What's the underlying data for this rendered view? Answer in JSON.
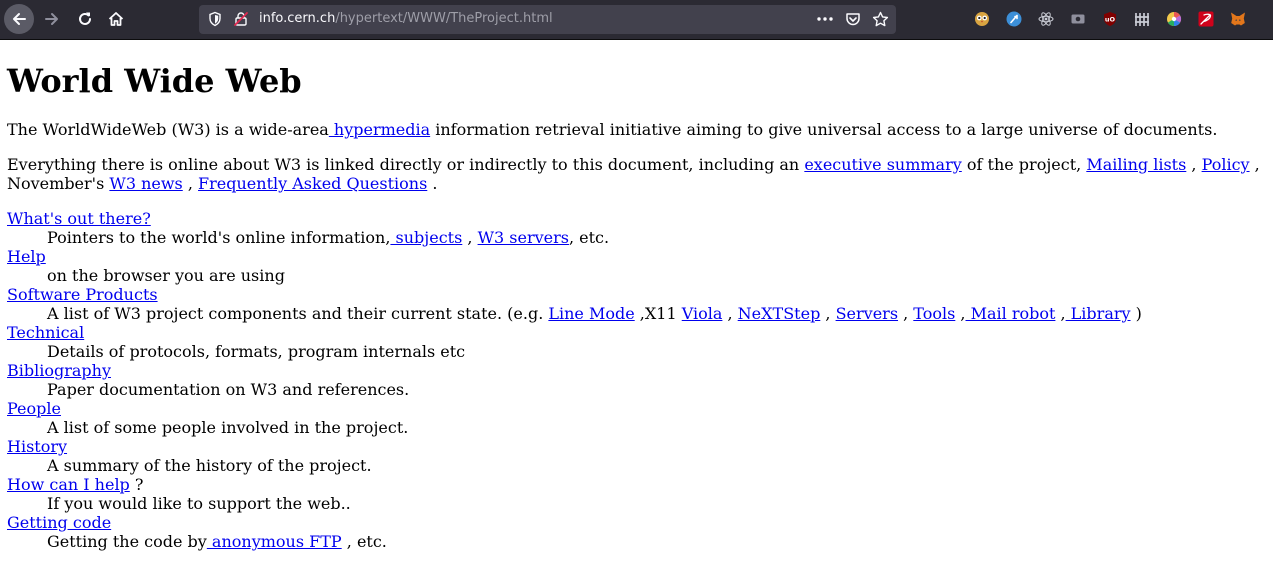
{
  "browser": {
    "url_host": "info.cern.ch",
    "url_path": "/hypertext/WWW/TheProject.html",
    "colors": {
      "toolbar": "#2b2a33",
      "urlbar": "#42414d",
      "link": "#0000ee"
    },
    "extension_icons": [
      "owl-extension-icon",
      "dark-reader-icon",
      "react-devtools-icon",
      "screenshot-icon",
      "ublock-origin-icon",
      "tracker-blocker-icon",
      "color-picker-icon",
      "feather-icon",
      "metamask-fox-icon"
    ]
  },
  "page": {
    "title": "World Wide Web",
    "intro": {
      "t1": "The WorldWideWeb (W3) is a wide-area",
      "link_hypermedia": " hypermedia",
      "t2": " information retrieval initiative aiming to give universal access to a large universe of documents."
    },
    "everything": {
      "t1": "Everything there is online about W3 is linked directly or indirectly to this document, including an ",
      "link_exec": "executive summary",
      "t2": " of the project, ",
      "link_mailing": "Mailing lists",
      "t3": " , ",
      "link_policy": "Policy",
      "t4": " , November's ",
      "link_news": "W3 news",
      "t5": " , ",
      "link_faq": "Frequently Asked Questions",
      "t6": " ."
    },
    "whats_out": {
      "title": "What's out there?",
      "d1": "Pointers to the world's online information,",
      "link_subjects": " subjects",
      "d2": " , ",
      "link_servers": "W3 servers",
      "d3": ", etc."
    },
    "help": {
      "title": "Help",
      "desc": "on the browser you are using"
    },
    "software": {
      "title": "Software Products",
      "d1": "A list of W3 project components and their current state. (e.g. ",
      "link_linemode": "Line Mode",
      "d2": " ,X11 ",
      "link_viola": "Viola",
      "d3": " , ",
      "link_nextstep": "NeXTStep",
      "d4": " , ",
      "link_servers": "Servers",
      "d5": " , ",
      "link_tools": "Tools",
      "d6": " ,",
      "link_mailrobot": " Mail robot",
      "d7": " ,",
      "link_library": " Library",
      "d8": " )"
    },
    "technical": {
      "title": "Technical",
      "desc": "Details of protocols, formats, program internals etc"
    },
    "bibliography": {
      "title": "Bibliography",
      "desc": "Paper documentation on W3 and references."
    },
    "people": {
      "title": "People",
      "desc": "A list of some people involved in the project."
    },
    "history": {
      "title": "History",
      "desc": "A summary of the history of the project."
    },
    "howhelp": {
      "title": "How can I help",
      "after": " ?",
      "desc": "If you would like to support the web.."
    },
    "getting": {
      "title": "Getting code",
      "d1": "Getting the code by",
      "link_ftp": " anonymous FTP",
      "d2": " , etc."
    }
  }
}
